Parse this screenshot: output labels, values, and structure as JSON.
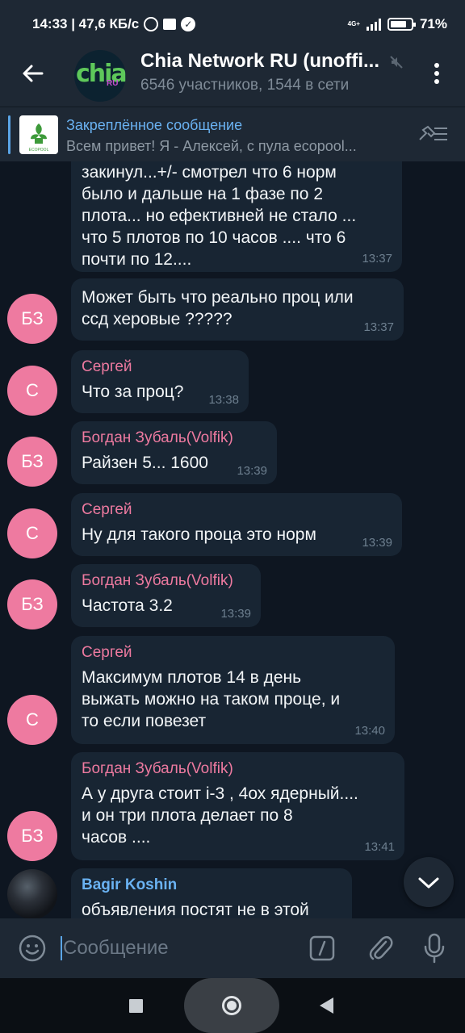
{
  "status_bar": {
    "time_and_speed": "14:33 | 47,6 КБ/с",
    "network": "4G+",
    "battery": "71%"
  },
  "header": {
    "title": "Chia Network RU (unoffi...",
    "subtitle": "6546 участников, 1544 в сети",
    "logo_text": "chia",
    "logo_badge": "RU"
  },
  "pinned": {
    "title": "Закреплённое сообщение",
    "text": "Всем привет!  Я - Алексей, с пула ecopool...",
    "thumb_label": "ECOPOOL"
  },
  "messages": [
    {
      "sender": "",
      "text": "закинул...+/- смотрел что 6 норм\nбыло и дальше на 1 фазе по 2\nплота... но ефективней не стало ...\nчто 5 плотов по 10 часов .... что 6\nпочти по 12....",
      "time": "13:37",
      "avatar": ""
    },
    {
      "sender": "",
      "text": "Может быть что реально проц или\nссд херовые ?????",
      "time": "13:37",
      "avatar": "БЗ"
    },
    {
      "sender": "Сергей",
      "text": "Что за проц?",
      "time": "13:38",
      "avatar": "С"
    },
    {
      "sender": "Богдан Зубаль(Volfik)",
      "text": "Райзен 5... 1600",
      "time": "13:39",
      "avatar": "БЗ"
    },
    {
      "sender": "Сергей",
      "text": "Ну для такого проца это норм",
      "time": "13:39",
      "avatar": "С"
    },
    {
      "sender": "Богдан Зубаль(Volfik)",
      "text": "Частота 3.2",
      "time": "13:39",
      "avatar": "БЗ"
    },
    {
      "sender": "Сергей",
      "text": "Максимум плотов 14 в день\nвыжать можно на таком проце, и\nто если повезет",
      "time": "13:40",
      "avatar": "С"
    },
    {
      "sender": "Богдан Зубаль(Volfik)",
      "text": "А у друга стоит i-3 , 4ох ядерный....\nи он три плота делает по 8\nчасов ....",
      "time": "13:41",
      "avatar": "БЗ"
    },
    {
      "sender": "Bagir Koshin",
      "text": "объявления постят не в этой",
      "time": "",
      "avatar": ""
    }
  ],
  "colors": {
    "sender_sergey": "#ee7aa0",
    "sender_bogdan": "#ee7aa0",
    "sender_bagir": "#6ab2f2",
    "accent": "#5aa5e6"
  },
  "input": {
    "placeholder": "Сообщение"
  }
}
